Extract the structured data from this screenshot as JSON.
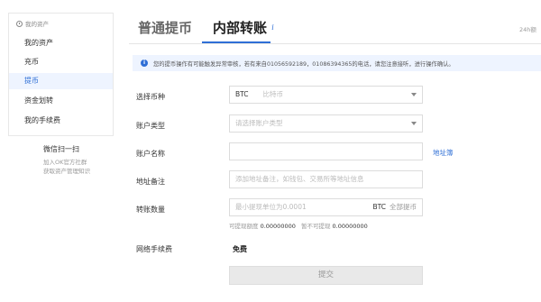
{
  "sidebar": {
    "header": "我的资产",
    "items": [
      {
        "label": "我的资产"
      },
      {
        "label": "充币"
      },
      {
        "label": "提币"
      },
      {
        "label": "资金划转"
      },
      {
        "label": "我的手续费"
      }
    ],
    "active_index": 2
  },
  "qr": {
    "title": "微信扫一扫",
    "line1": "加入OK官方社群",
    "line2": "获取资产管理知识"
  },
  "tabs": [
    {
      "label": "普通提币"
    },
    {
      "label": "内部转账"
    }
  ],
  "tab_info_icon": "i",
  "top_right_text": "24h额",
  "notice": {
    "icon": "i",
    "text": "您的提币操作有可能触发异常审核，若有来自01056592189，01086394365的电话，请您注意接听，进行操作确认。"
  },
  "form": {
    "coin": {
      "label": "选择币种",
      "value": "BTC",
      "sub": "比特币"
    },
    "account_type": {
      "label": "账户类型",
      "placeholder": "请选择账户类型"
    },
    "account_name": {
      "label": "账户名称",
      "value": "",
      "link": "地址簿"
    },
    "address_note": {
      "label": "地址备注",
      "placeholder": "添加地址备注，如钱包、交易所等地址信息"
    },
    "amount": {
      "label": "转账数量",
      "placeholder": "最小提现单位为0.0001",
      "unit": "BTC",
      "all_label": "全部提币",
      "available_label": "可提现额度",
      "available_value": "0.00000000",
      "frozen_label": "暂不可提现",
      "frozen_value": "0.00000000"
    },
    "fee": {
      "label": "网络手续费",
      "value": "免费"
    },
    "submit_label": "提交"
  },
  "colors": {
    "accent": "#2f6fd6",
    "active_bg": "#eef4ff",
    "border": "#dcdcdc"
  }
}
